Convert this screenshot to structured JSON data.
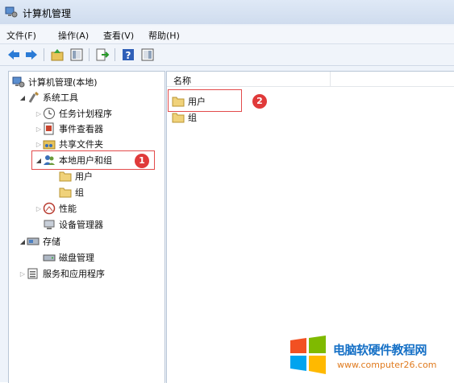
{
  "window": {
    "title": "计算机管理"
  },
  "menu": [
    {
      "label": "文件(F)"
    },
    {
      "label": "操作(A)"
    },
    {
      "label": "查看(V)"
    },
    {
      "label": "帮助(H)"
    }
  ],
  "tree": {
    "root": "计算机管理(本地)",
    "system_tools": "系统工具",
    "task_scheduler": "任务计划程序",
    "event_viewer": "事件查看器",
    "shared_folders": "共享文件夹",
    "local_users": "本地用户和组",
    "users": "用户",
    "groups": "组",
    "performance": "性能",
    "device_manager": "设备管理器",
    "storage": "存储",
    "disk_mgmt": "磁盘管理",
    "services": "服务和应用程序"
  },
  "list": {
    "column": "名称",
    "items": [
      {
        "label": "用户"
      },
      {
        "label": "组"
      }
    ]
  },
  "annotations": {
    "badge1": "1",
    "badge2": "2"
  },
  "watermark": {
    "title": "电脑软硬件教程网",
    "url": "www.computer26.com"
  }
}
